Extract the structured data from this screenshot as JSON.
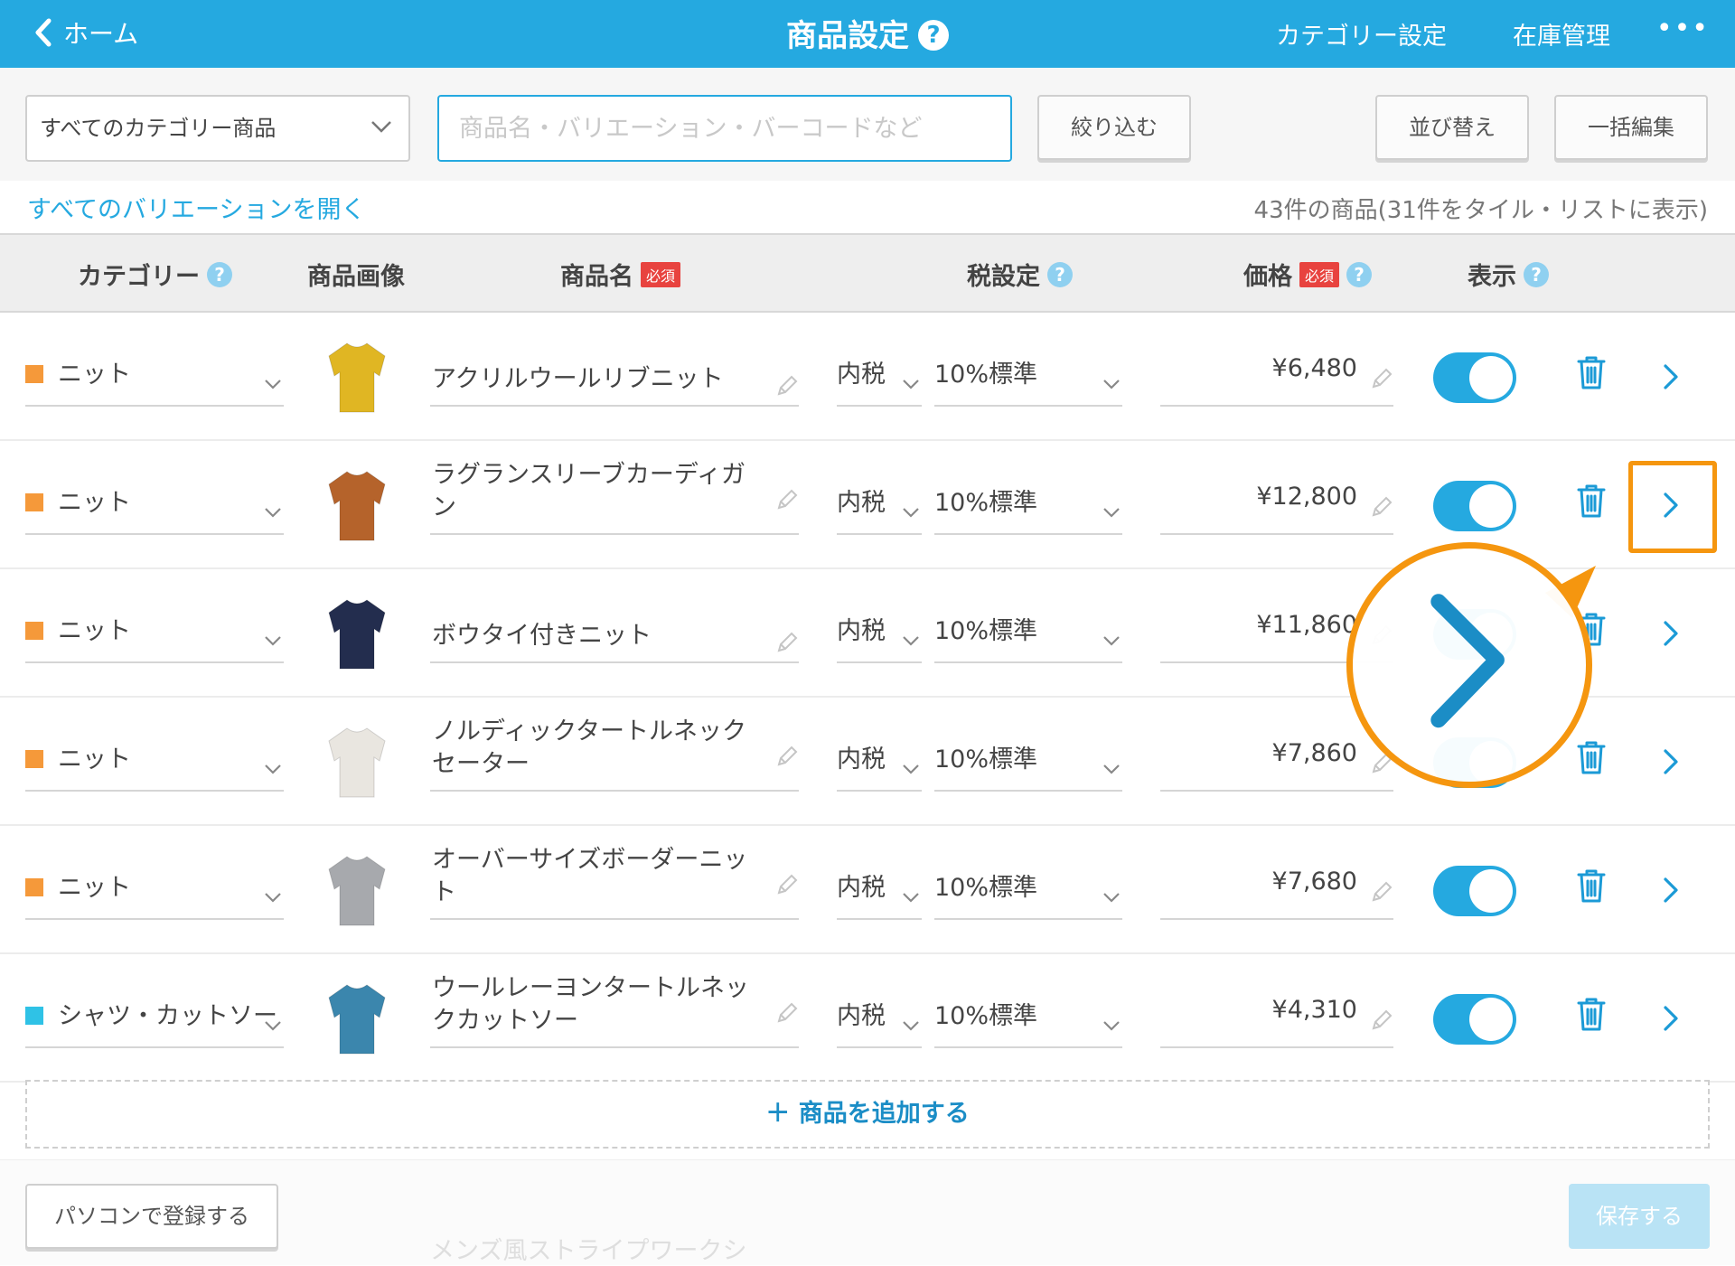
{
  "header": {
    "back_label": "ホーム",
    "title": "商品設定",
    "help": "?",
    "category_settings": "カテゴリー設定",
    "inventory": "在庫管理",
    "more": "•••"
  },
  "filters": {
    "category_select": "すべてのカテゴリー商品",
    "search_placeholder": "商品名・バリエーション・バーコードなど",
    "filter_button": "絞り込む",
    "sort_button": "並び替え",
    "bulk_edit_button": "一括編集"
  },
  "info": {
    "open_variations": "すべてのバリエーションを開く",
    "count": "43件の商品(31件をタイル・リストに表示)"
  },
  "columns": {
    "category": "カテゴリー",
    "image": "商品画像",
    "name": "商品名",
    "required": "必須",
    "tax": "税設定",
    "price": "価格",
    "display": "表示",
    "help": "?"
  },
  "rows": [
    {
      "category": "ニット",
      "category_color": "#f5993a",
      "name": "アクリルウールリブニット",
      "tax_type": "内税",
      "tax_rate": "10%標準",
      "price": "¥6,480",
      "visible": true,
      "thumb_color": "#e0b623"
    },
    {
      "category": "ニット",
      "category_color": "#f5993a",
      "name": "ラグランスリーブカーディガン",
      "tax_type": "内税",
      "tax_rate": "10%標準",
      "price": "¥12,800",
      "visible": true,
      "thumb_color": "#b5632b"
    },
    {
      "category": "ニット",
      "category_color": "#f5993a",
      "name": "ボウタイ付きニット",
      "tax_type": "内税",
      "tax_rate": "10%標準",
      "price": "¥11,860",
      "visible": true,
      "thumb_color": "#232d4e"
    },
    {
      "category": "ニット",
      "category_color": "#f5993a",
      "name": "ノルディックタートルネックセーター",
      "tax_type": "内税",
      "tax_rate": "10%標準",
      "price": "¥7,860",
      "visible": true,
      "thumb_color": "#e9e6e0"
    },
    {
      "category": "ニット",
      "category_color": "#f5993a",
      "name": "オーバーサイズボーダーニット",
      "tax_type": "内税",
      "tax_rate": "10%標準",
      "price": "¥7,680",
      "visible": true,
      "thumb_color": "#a7a9ad"
    },
    {
      "category": "シャツ・カットソー",
      "category_color": "#2fc2e6",
      "name": "ウールレーヨンタートルネックカットソー",
      "tax_type": "内税",
      "tax_rate": "10%標準",
      "price": "¥4,310",
      "visible": true,
      "thumb_color": "#3b86ad"
    }
  ],
  "add_product": "＋ 商品を追加する",
  "footer": {
    "pc_register": "パソコンで登録する",
    "save": "保存する",
    "next_row_hint": "メンズ風ストライプワークシ"
  },
  "colors": {
    "primary": "#25a9e0",
    "highlight": "#f5960f",
    "required": "#e8433f"
  }
}
